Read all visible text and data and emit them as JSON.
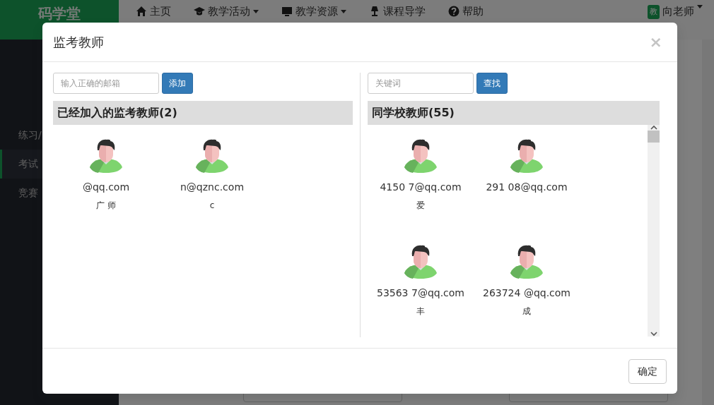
{
  "app": {
    "logo": "码学堂",
    "nav": [
      {
        "label": "主页",
        "dropdown": false
      },
      {
        "label": "教学活动",
        "dropdown": true
      },
      {
        "label": "教学资源",
        "dropdown": true
      },
      {
        "label": "课程导学",
        "dropdown": false
      },
      {
        "label": "帮助",
        "dropdown": false
      }
    ],
    "user": {
      "badge": "教",
      "name": "向老师"
    }
  },
  "sidebar": {
    "items": [
      {
        "label": "练习/",
        "selected": false
      },
      {
        "label": "考试",
        "selected": true
      },
      {
        "label": "竞赛",
        "selected": false
      }
    ]
  },
  "modal": {
    "title": "监考教师",
    "close": "×",
    "panels": [
      {
        "placeholder": "输入正确的邮箱",
        "button": "添加",
        "heading": "已经加入的监考教师(2)",
        "scrollable": false,
        "teachers": [
          {
            "email": "@qq.com",
            "name": "广 师"
          },
          {
            "email": "n@qznc.com",
            "name": "c"
          }
        ]
      },
      {
        "placeholder": "关键词",
        "button": "查找",
        "heading": "同学校教师(55)",
        "scrollable": true,
        "teachers": [
          {
            "email": "4150 7@qq.com",
            "name": "爱"
          },
          {
            "email": "291 08@qq.com"
          },
          {
            "email": "53563 7@qq.com",
            "name": "丰"
          },
          {
            "email": "263724 @qq.com",
            "name": "成"
          }
        ]
      }
    ],
    "footer_button": "确定"
  }
}
